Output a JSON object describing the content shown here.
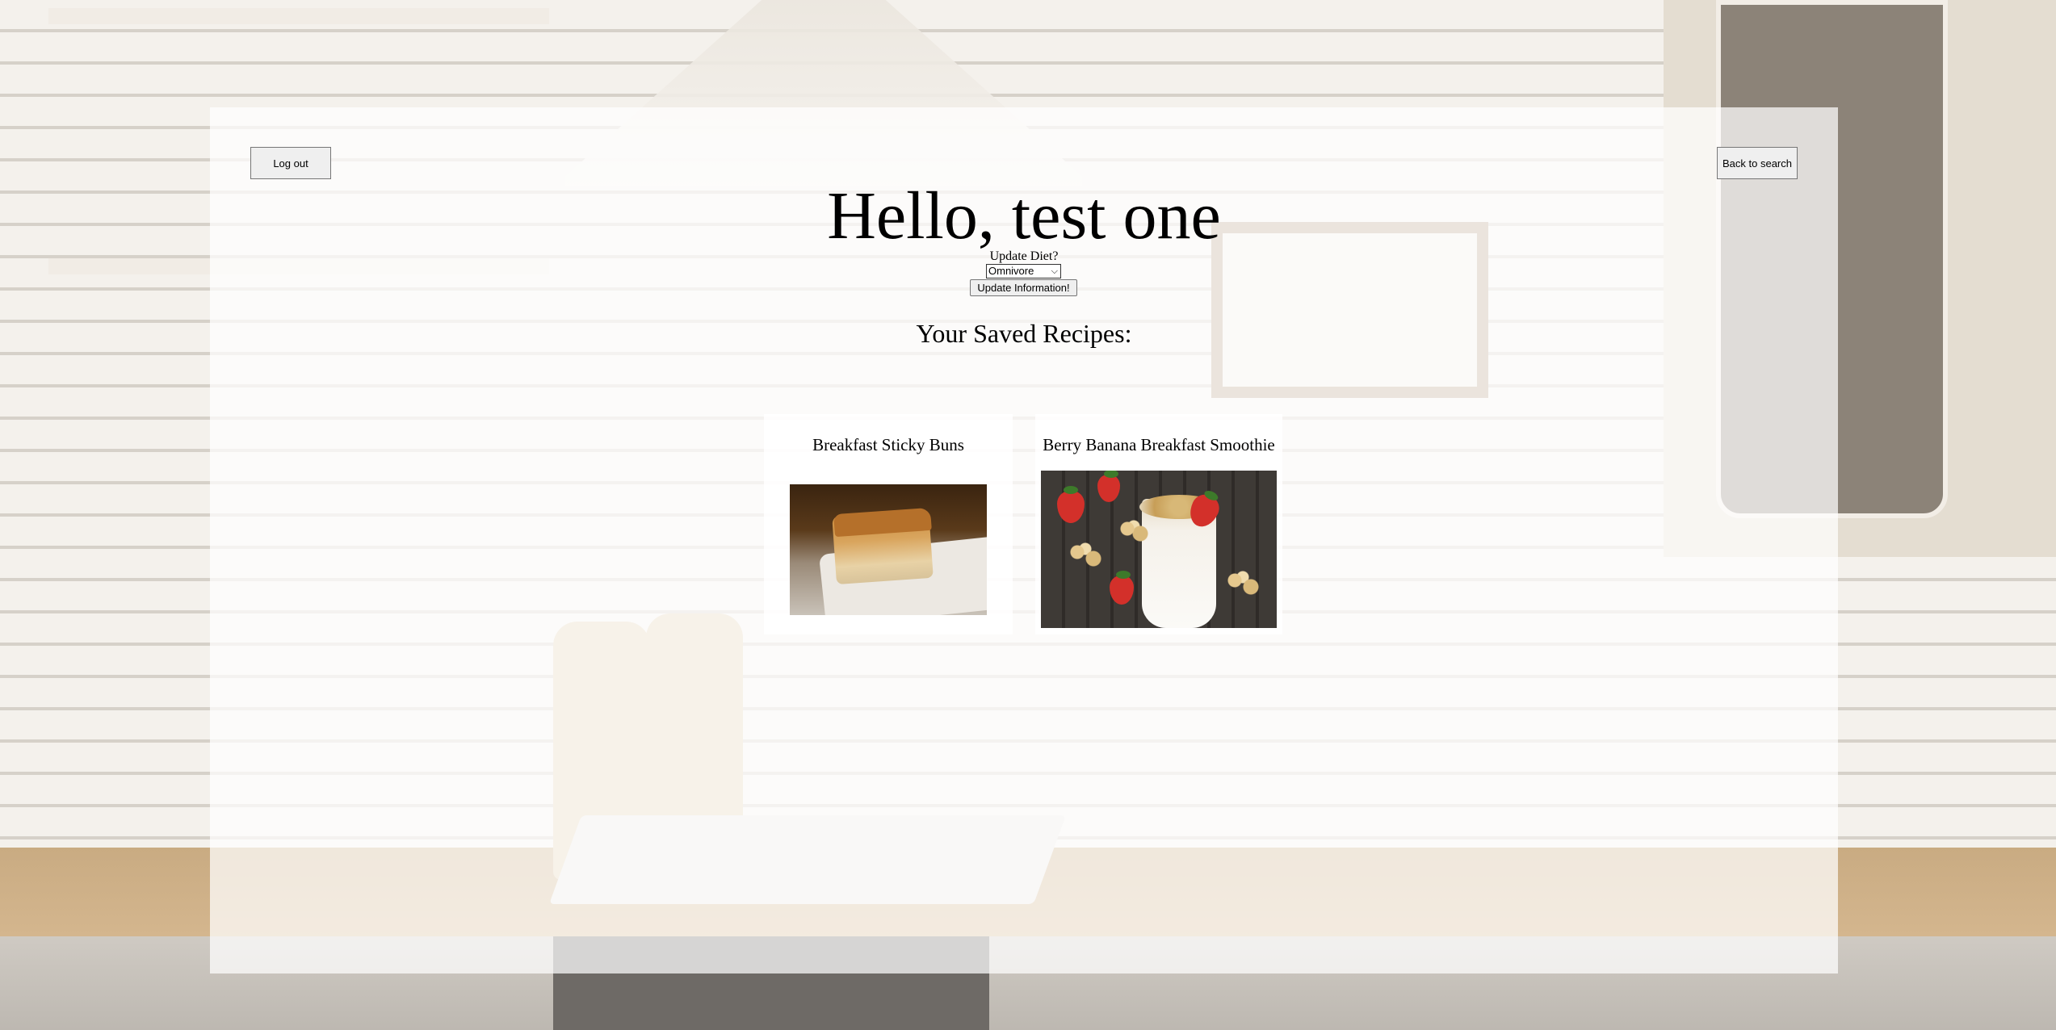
{
  "header": {
    "logout_label": "Log out",
    "back_label": "Back to search"
  },
  "profile": {
    "greeting": "Hello, test one",
    "update_diet_label": "Update Diet?",
    "diet_selected": "Omnivore",
    "update_button_label": "Update Information!"
  },
  "saved": {
    "heading": "Your Saved Recipes:",
    "recipes": [
      {
        "title": "Breakfast Sticky Buns",
        "image": "sticky-bun-photo"
      },
      {
        "title": "Berry Banana Breakfast Smoothie",
        "image": "smoothie-photo"
      }
    ]
  },
  "colors": {
    "panel_background": "#ffffff",
    "button_background": "#efefef",
    "button_border": "#767676"
  }
}
